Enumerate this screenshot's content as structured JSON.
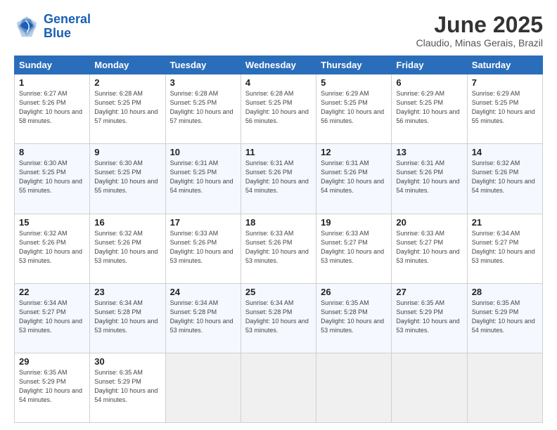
{
  "header": {
    "logo_line1": "General",
    "logo_line2": "Blue",
    "title": "June 2025",
    "subtitle": "Claudio, Minas Gerais, Brazil"
  },
  "columns": [
    "Sunday",
    "Monday",
    "Tuesday",
    "Wednesday",
    "Thursday",
    "Friday",
    "Saturday"
  ],
  "weeks": [
    [
      {
        "day": "1",
        "sunrise": "6:27 AM",
        "sunset": "5:26 PM",
        "daylight": "10 hours and 58 minutes."
      },
      {
        "day": "2",
        "sunrise": "6:28 AM",
        "sunset": "5:25 PM",
        "daylight": "10 hours and 57 minutes."
      },
      {
        "day": "3",
        "sunrise": "6:28 AM",
        "sunset": "5:25 PM",
        "daylight": "10 hours and 57 minutes."
      },
      {
        "day": "4",
        "sunrise": "6:28 AM",
        "sunset": "5:25 PM",
        "daylight": "10 hours and 56 minutes."
      },
      {
        "day": "5",
        "sunrise": "6:29 AM",
        "sunset": "5:25 PM",
        "daylight": "10 hours and 56 minutes."
      },
      {
        "day": "6",
        "sunrise": "6:29 AM",
        "sunset": "5:25 PM",
        "daylight": "10 hours and 56 minutes."
      },
      {
        "day": "7",
        "sunrise": "6:29 AM",
        "sunset": "5:25 PM",
        "daylight": "10 hours and 55 minutes."
      }
    ],
    [
      {
        "day": "8",
        "sunrise": "6:30 AM",
        "sunset": "5:25 PM",
        "daylight": "10 hours and 55 minutes."
      },
      {
        "day": "9",
        "sunrise": "6:30 AM",
        "sunset": "5:25 PM",
        "daylight": "10 hours and 55 minutes."
      },
      {
        "day": "10",
        "sunrise": "6:31 AM",
        "sunset": "5:25 PM",
        "daylight": "10 hours and 54 minutes."
      },
      {
        "day": "11",
        "sunrise": "6:31 AM",
        "sunset": "5:26 PM",
        "daylight": "10 hours and 54 minutes."
      },
      {
        "day": "12",
        "sunrise": "6:31 AM",
        "sunset": "5:26 PM",
        "daylight": "10 hours and 54 minutes."
      },
      {
        "day": "13",
        "sunrise": "6:31 AM",
        "sunset": "5:26 PM",
        "daylight": "10 hours and 54 minutes."
      },
      {
        "day": "14",
        "sunrise": "6:32 AM",
        "sunset": "5:26 PM",
        "daylight": "10 hours and 54 minutes."
      }
    ],
    [
      {
        "day": "15",
        "sunrise": "6:32 AM",
        "sunset": "5:26 PM",
        "daylight": "10 hours and 53 minutes."
      },
      {
        "day": "16",
        "sunrise": "6:32 AM",
        "sunset": "5:26 PM",
        "daylight": "10 hours and 53 minutes."
      },
      {
        "day": "17",
        "sunrise": "6:33 AM",
        "sunset": "5:26 PM",
        "daylight": "10 hours and 53 minutes."
      },
      {
        "day": "18",
        "sunrise": "6:33 AM",
        "sunset": "5:26 PM",
        "daylight": "10 hours and 53 minutes."
      },
      {
        "day": "19",
        "sunrise": "6:33 AM",
        "sunset": "5:27 PM",
        "daylight": "10 hours and 53 minutes."
      },
      {
        "day": "20",
        "sunrise": "6:33 AM",
        "sunset": "5:27 PM",
        "daylight": "10 hours and 53 minutes."
      },
      {
        "day": "21",
        "sunrise": "6:34 AM",
        "sunset": "5:27 PM",
        "daylight": "10 hours and 53 minutes."
      }
    ],
    [
      {
        "day": "22",
        "sunrise": "6:34 AM",
        "sunset": "5:27 PM",
        "daylight": "10 hours and 53 minutes."
      },
      {
        "day": "23",
        "sunrise": "6:34 AM",
        "sunset": "5:28 PM",
        "daylight": "10 hours and 53 minutes."
      },
      {
        "day": "24",
        "sunrise": "6:34 AM",
        "sunset": "5:28 PM",
        "daylight": "10 hours and 53 minutes."
      },
      {
        "day": "25",
        "sunrise": "6:34 AM",
        "sunset": "5:28 PM",
        "daylight": "10 hours and 53 minutes."
      },
      {
        "day": "26",
        "sunrise": "6:35 AM",
        "sunset": "5:28 PM",
        "daylight": "10 hours and 53 minutes."
      },
      {
        "day": "27",
        "sunrise": "6:35 AM",
        "sunset": "5:29 PM",
        "daylight": "10 hours and 53 minutes."
      },
      {
        "day": "28",
        "sunrise": "6:35 AM",
        "sunset": "5:29 PM",
        "daylight": "10 hours and 54 minutes."
      }
    ],
    [
      {
        "day": "29",
        "sunrise": "6:35 AM",
        "sunset": "5:29 PM",
        "daylight": "10 hours and 54 minutes."
      },
      {
        "day": "30",
        "sunrise": "6:35 AM",
        "sunset": "5:29 PM",
        "daylight": "10 hours and 54 minutes."
      },
      null,
      null,
      null,
      null,
      null
    ]
  ]
}
